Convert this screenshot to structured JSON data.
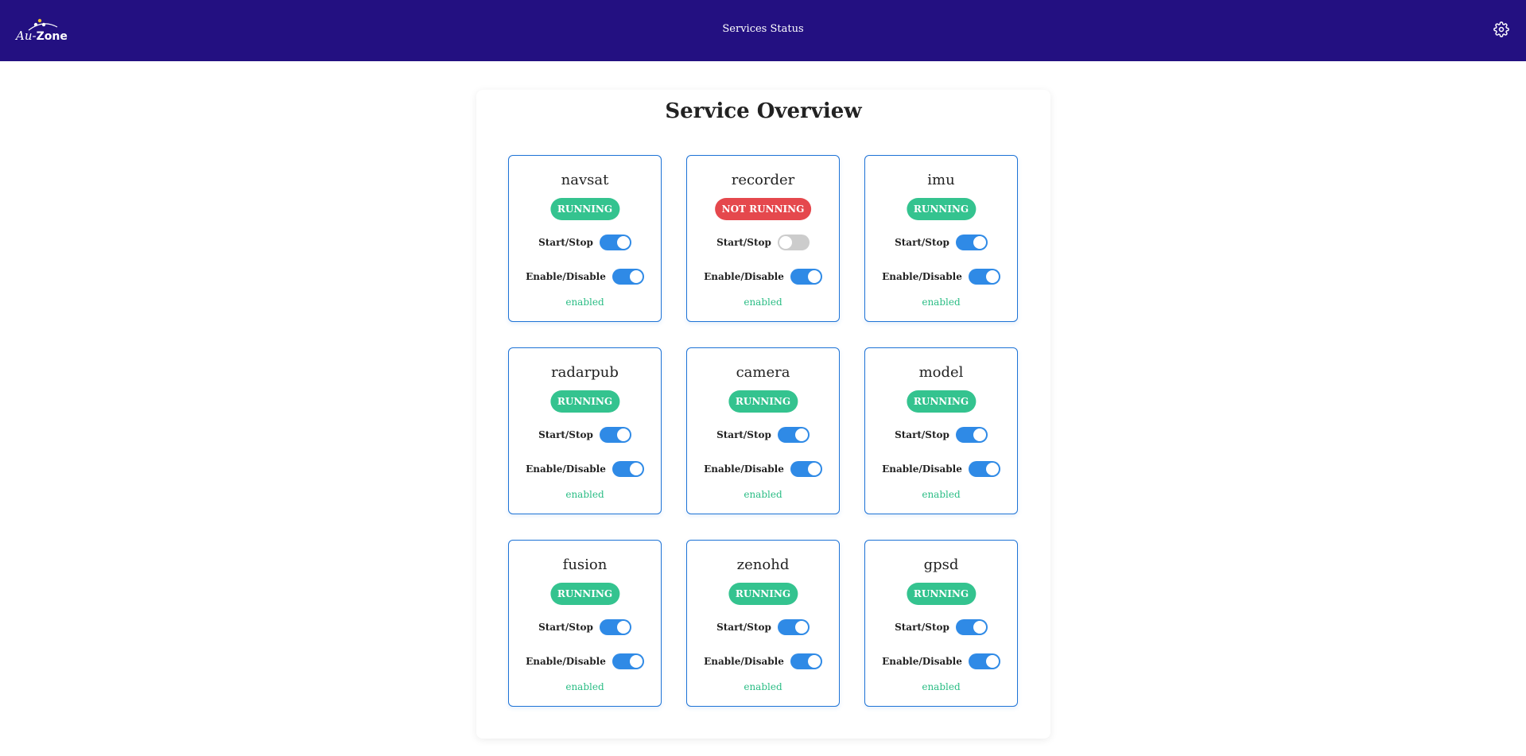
{
  "header": {
    "title": "Services Status",
    "logo": {
      "text_italic": "Au",
      "text_bold": "Zone",
      "separator": "-"
    },
    "settings_icon": "gear-icon"
  },
  "panel": {
    "title": "Service Overview"
  },
  "colors": {
    "header_bg": "#231081",
    "running": "#34c38f",
    "not_running": "#e5484d",
    "toggle_on": "#2f8ae6",
    "toggle_off": "#cccccc",
    "enabled_text": "#2bbd85",
    "card_border": "#1e73d6"
  },
  "labels": {
    "start_stop": "Start/Stop",
    "enable_disable": "Enable/Disable"
  },
  "services": [
    {
      "name": "navsat",
      "status": "RUNNING",
      "running": true,
      "started": true,
      "enabled": true,
      "state": "enabled"
    },
    {
      "name": "recorder",
      "status": "NOT RUNNING",
      "running": false,
      "started": false,
      "enabled": true,
      "state": "enabled"
    },
    {
      "name": "imu",
      "status": "RUNNING",
      "running": true,
      "started": true,
      "enabled": true,
      "state": "enabled"
    },
    {
      "name": "radarpub",
      "status": "RUNNING",
      "running": true,
      "started": true,
      "enabled": true,
      "state": "enabled"
    },
    {
      "name": "camera",
      "status": "RUNNING",
      "running": true,
      "started": true,
      "enabled": true,
      "state": "enabled"
    },
    {
      "name": "model",
      "status": "RUNNING",
      "running": true,
      "started": true,
      "enabled": true,
      "state": "enabled"
    },
    {
      "name": "fusion",
      "status": "RUNNING",
      "running": true,
      "started": true,
      "enabled": true,
      "state": "enabled"
    },
    {
      "name": "zenohd",
      "status": "RUNNING",
      "running": true,
      "started": true,
      "enabled": true,
      "state": "enabled"
    },
    {
      "name": "gpsd",
      "status": "RUNNING",
      "running": true,
      "started": true,
      "enabled": true,
      "state": "enabled"
    }
  ]
}
